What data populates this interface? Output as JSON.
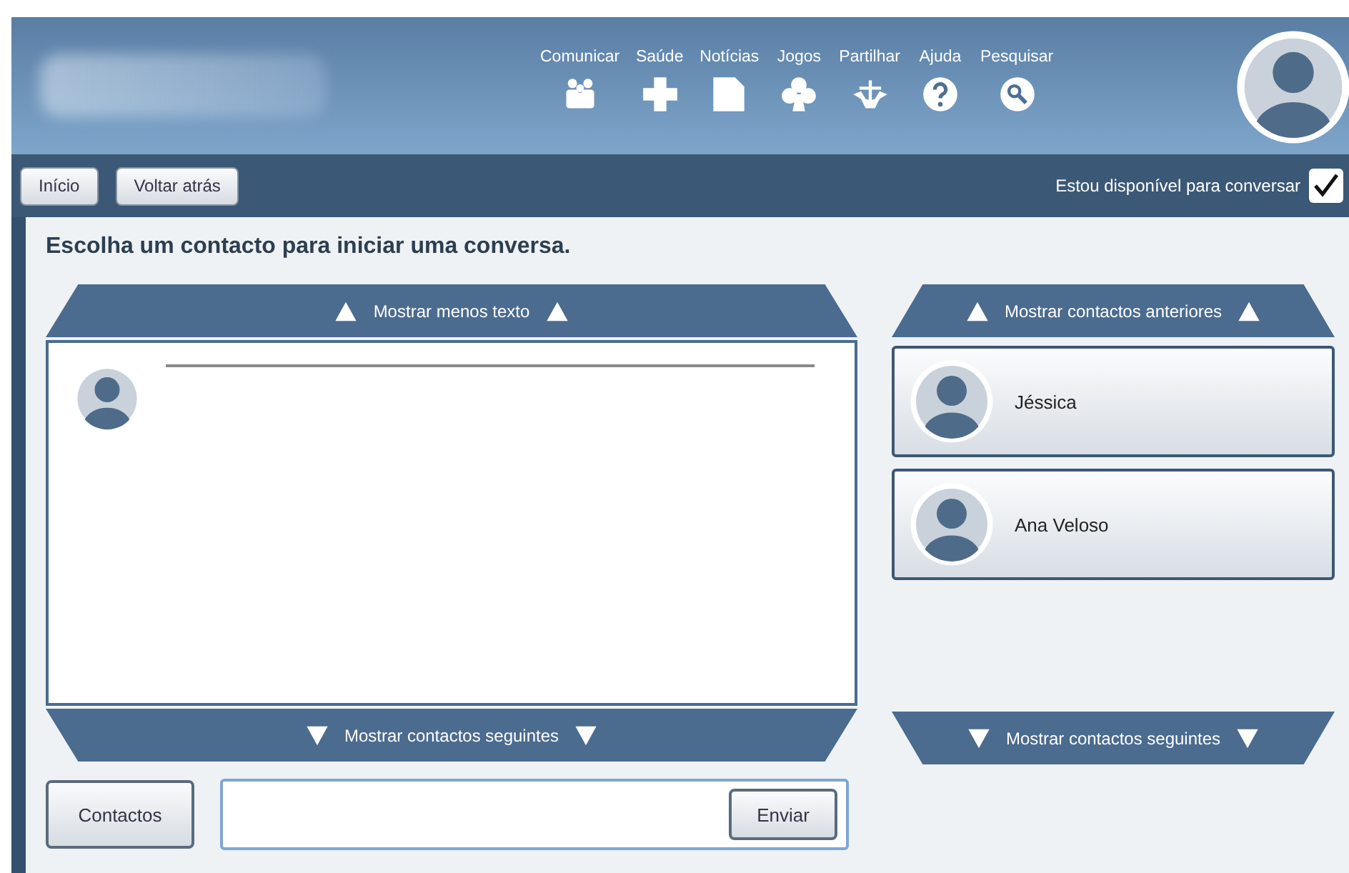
{
  "header": {
    "nav": [
      {
        "label": "Comunicar",
        "kind": "people"
      },
      {
        "label": "Saúde",
        "kind": "plus"
      },
      {
        "label": "Notícias",
        "kind": "document"
      },
      {
        "label": "Jogos",
        "kind": "club"
      },
      {
        "label": "Partilhar",
        "kind": "anchor"
      },
      {
        "label": "Ajuda",
        "kind": "help"
      },
      {
        "label": "Pesquisar",
        "kind": "search"
      }
    ]
  },
  "toolbar": {
    "buttons": [
      "Início",
      "Voltar atrás"
    ],
    "availability": {
      "label": "Estou disponível para conversar",
      "checked": true
    }
  },
  "title": "Escolha um contacto para iniciar uma conversa.",
  "chat": {
    "show_less": "Mostrar menos texto",
    "show_next": "Mostrar contactos seguintes",
    "contacts_button": "Contactos",
    "send_button": "Enviar"
  },
  "contacts": {
    "show_previous": "Mostrar contactos anteriores",
    "items": [
      {
        "name": "Jéssica"
      },
      {
        "name": "Ana Veloso"
      }
    ],
    "show_next": "Mostrar contactos seguintes"
  }
}
